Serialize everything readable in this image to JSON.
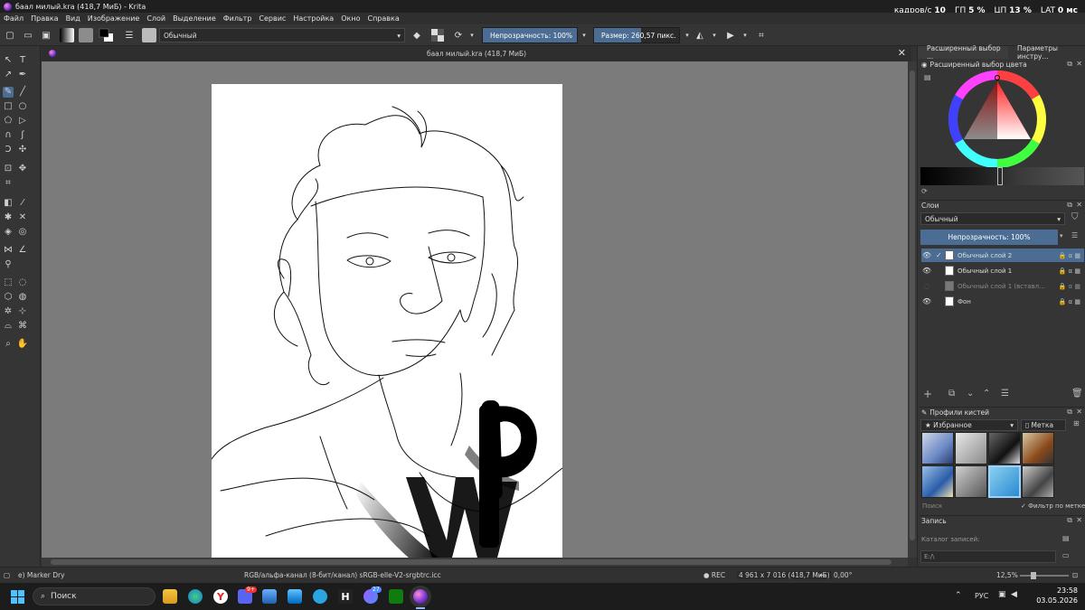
{
  "window": {
    "title": "баал милый.kra (418,7 МиБ)  - Krita"
  },
  "perf": {
    "fps_label": "кадров/с",
    "fps_value": "10",
    "gpu_label": "ГП",
    "gpu_value": "5 %",
    "cpu_label": "ЦП",
    "cpu_value": "13 %",
    "lat_label": "LAT",
    "lat_value": "0 мс"
  },
  "menu": [
    "Файл",
    "Правка",
    "Вид",
    "Изображение",
    "Слой",
    "Выделение",
    "Фильтр",
    "Сервис",
    "Настройка",
    "Окно",
    "Справка"
  ],
  "toolbar": {
    "blend_mode": "Обычный",
    "opacity_label": "Непрозрачность: 100%",
    "opacity_value": 1.0,
    "size_label": "Размер: 260,57 пикс.",
    "size_fill": 0.55
  },
  "document": {
    "tab_title": "баал милый.kra (418,7 МиБ)",
    "watermark_text": "WIP"
  },
  "dock": {
    "tab_color": "Расширенный выбор ...",
    "tab_tool": "Параметры инстру...",
    "color_header": "Расширенный выбор цвета",
    "layers_header": "Слои",
    "layers_blend": "Обычный",
    "layers_opacity": "Непрозрачность:  100%",
    "layers": [
      {
        "name": "Обычный слой 2",
        "selected": true,
        "visible": true
      },
      {
        "name": "Обычный слой 1",
        "selected": false,
        "visible": true
      },
      {
        "name": "Обычный слой 1 (вставл...",
        "selected": false,
        "visible": false
      },
      {
        "name": "Фон",
        "selected": false,
        "visible": true
      }
    ],
    "brush_header": "Профили кистей",
    "brush_tag": "Избранное",
    "brush_label": "Метка",
    "brush_search": "Поиск",
    "brush_filter": "Фильтр по метке",
    "record_header": "Запись",
    "record_catalog": "Каталог записей:",
    "record_path": "E:/\\"
  },
  "status": {
    "brush": "e) Marker Dry",
    "colorspace": "RGB/альфа-канал (8-бит/канал)  sRGB-elle-V2-srgbtrc.icc",
    "rec": "● REC",
    "dimensions": "4 961 x 7 016 (418,7 МиБ)",
    "rotation": "0,00°",
    "zoom": "12,5%"
  },
  "taskbar": {
    "search": "Поиск",
    "lang": "РУС",
    "time": "23:58",
    "date": "03.05.2026",
    "discord_badge": "9+",
    "telegram_badge": "27"
  },
  "colors": {
    "accent": "#4b6d94",
    "canvas_bg": "#7b7b7b",
    "panel": "#353535"
  }
}
